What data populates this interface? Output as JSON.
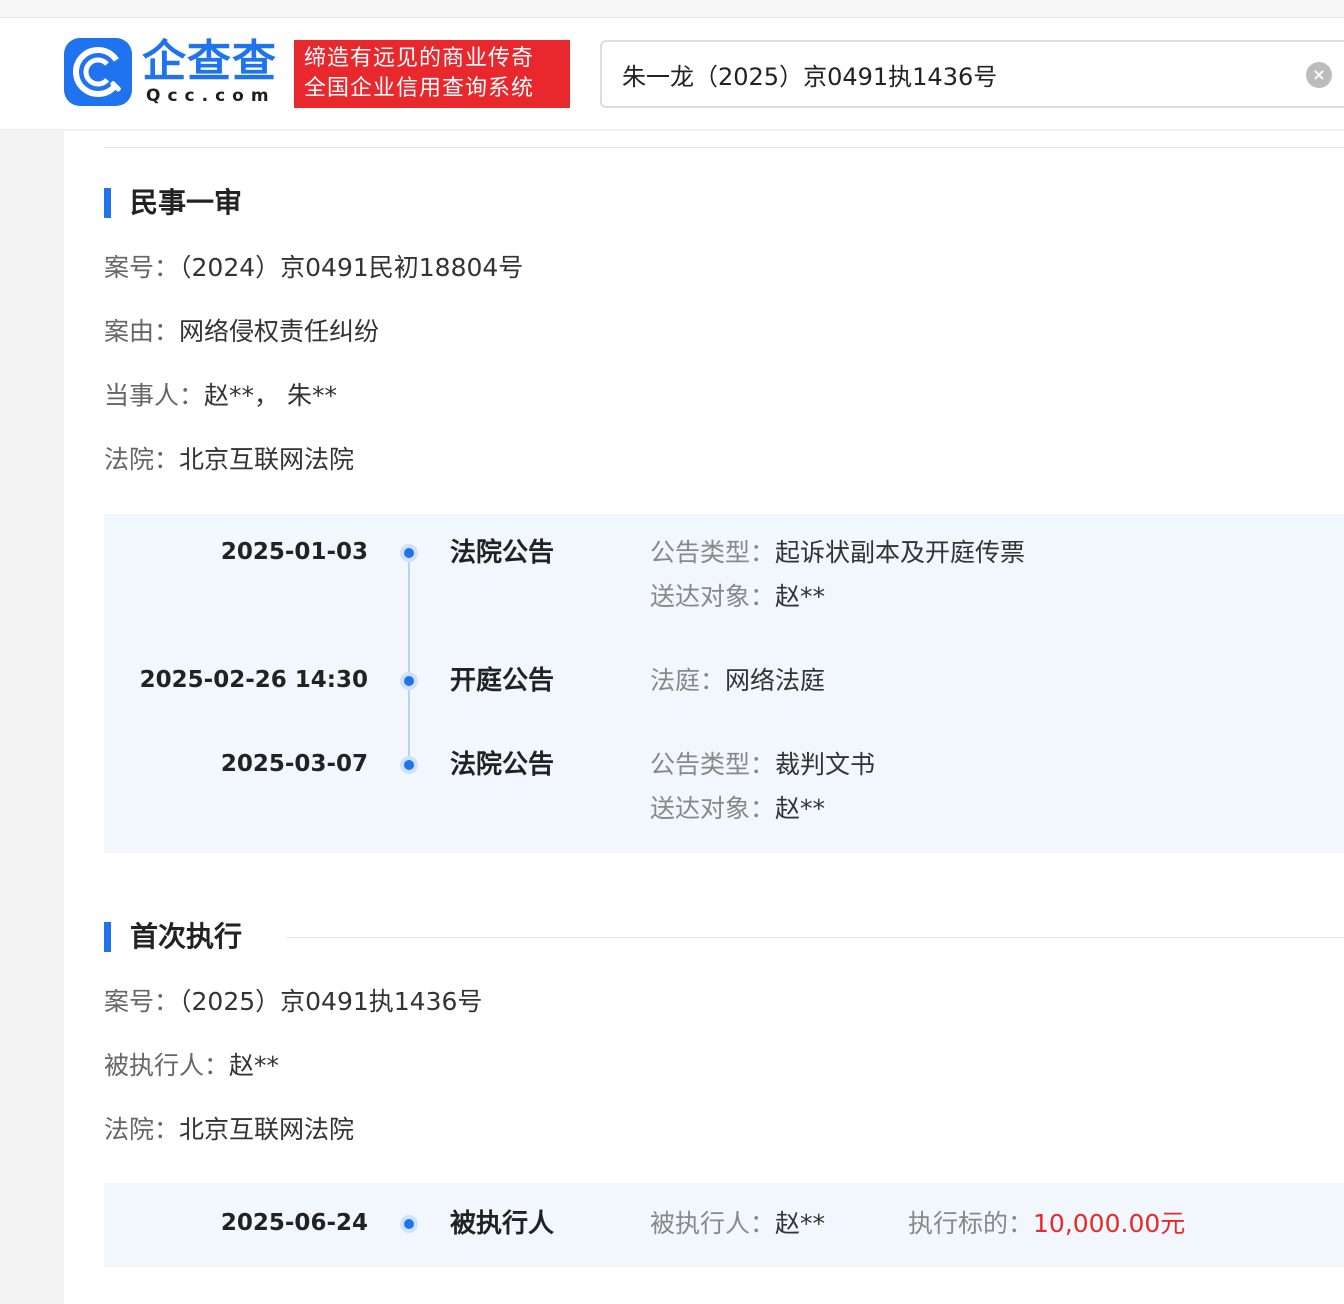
{
  "header": {
    "logo_cn": "企查查",
    "logo_en": "Qcc.com",
    "slogan_line1": "缔造有远见的商业传奇",
    "slogan_line2": "全国企业信用查询系统",
    "search_value": "朱一龙（2025）京0491执1436号",
    "clear_icon": "×",
    "brand_color": "#1f73ef",
    "slogan_color": "#e8282d"
  },
  "first_trial": {
    "title": "民事一审",
    "case_no_label": "案号：",
    "case_no": "（2024）京0491民初18804号",
    "cause_label": "案由：",
    "cause": "网络侵权责任纠纷",
    "parties_label": "当事人：",
    "parties": "赵**， 朱**",
    "court_label": "法院：",
    "court": "北京互联网法院",
    "timeline": [
      {
        "date": "2025-01-03",
        "type": "法院公告",
        "details": [
          {
            "label": "公告类型：",
            "value": "起诉状副本及开庭传票"
          },
          {
            "label": "送达对象：",
            "value": "赵**"
          }
        ]
      },
      {
        "date": "2025-02-26 14:30",
        "type": "开庭公告",
        "details": [
          {
            "label": "法庭：",
            "value": "网络法庭"
          }
        ]
      },
      {
        "date": "2025-03-07",
        "type": "法院公告",
        "details": [
          {
            "label": "公告类型：",
            "value": "裁判文书"
          },
          {
            "label": "送达对象：",
            "value": "赵**"
          }
        ]
      }
    ]
  },
  "execution": {
    "title": "首次执行",
    "case_no_label": "案号：",
    "case_no": "（2025）京0491执1436号",
    "respondent_label": "被执行人：",
    "respondent": "赵**",
    "court_label": "法院：",
    "court": "北京互联网法院",
    "timeline": [
      {
        "date": "2025-06-24",
        "type": "被执行人",
        "respondent_label": "被执行人：",
        "respondent": "赵**",
        "target_label": "执行标的：",
        "target": "10,000.00元"
      }
    ]
  }
}
